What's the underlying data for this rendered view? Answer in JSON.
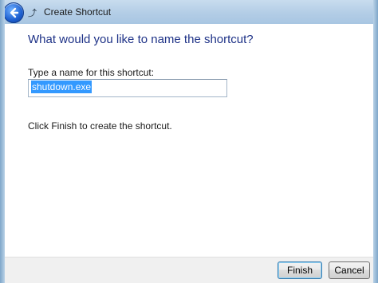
{
  "window": {
    "title": "Create Shortcut"
  },
  "page": {
    "heading": "What would you like to name the shortcut?",
    "name_label": "Type a name for this shortcut:",
    "name_value": "shutdown.exe",
    "finish_hint": "Click Finish to create the shortcut."
  },
  "buttons": {
    "finish": "Finish",
    "cancel": "Cancel"
  },
  "icons": {
    "back": "back-arrow-icon",
    "forward": "forward-arrow-icon"
  },
  "colors": {
    "heading": "#1e3287",
    "selection": "#3399ff",
    "titlebar": "#b3cde6"
  }
}
